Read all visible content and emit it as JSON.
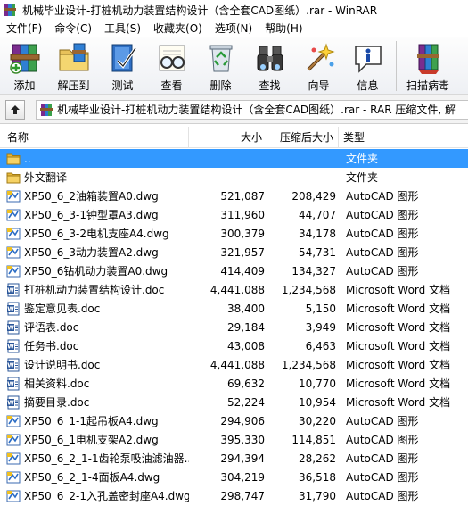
{
  "window": {
    "title": "机械毕业设计-打桩机动力装置结构设计（含全套CAD图纸）.rar - WinRAR"
  },
  "menu": [
    "文件(F)",
    "命令(C)",
    "工具(S)",
    "收藏夹(O)",
    "选项(N)",
    "帮助(H)"
  ],
  "toolbar": [
    {
      "label": "添加",
      "icon": "add-books-icon"
    },
    {
      "label": "解压到",
      "icon": "extract-folder-icon"
    },
    {
      "label": "测试",
      "icon": "test-check-icon"
    },
    {
      "label": "查看",
      "icon": "view-glasses-icon"
    },
    {
      "label": "删除",
      "icon": "delete-recycle-icon"
    },
    {
      "label": "查找",
      "icon": "find-binoculars-icon"
    },
    {
      "label": "向导",
      "icon": "wizard-wand-icon"
    },
    {
      "label": "信息",
      "icon": "info-icon"
    },
    {
      "label": "扫描病毒",
      "icon": "virus-scan-icon"
    }
  ],
  "address": {
    "text": "机械毕业设计-打桩机动力装置结构设计（含全套CAD图纸）.rar - RAR 压缩文件, 解"
  },
  "columns": {
    "name": "名称",
    "size": "大小",
    "packed": "压缩后大小",
    "type": "类型"
  },
  "colors": {
    "selection": "#3399ff",
    "folder": "#f0c24a",
    "dwg": "#2b6cc4",
    "doc": "#2b579a"
  },
  "files": [
    {
      "name": "..",
      "size": "",
      "packed": "",
      "type": "文件夹",
      "kind": "folder",
      "selected": true
    },
    {
      "name": "外文翻译",
      "size": "",
      "packed": "",
      "type": "文件夹",
      "kind": "folder"
    },
    {
      "name": "XP50_6_2油箱装置A0.dwg",
      "size": "521,087",
      "packed": "208,429",
      "type": "AutoCAD 图形",
      "kind": "dwg"
    },
    {
      "name": "XP50_6_3-1钟型罩A3.dwg",
      "size": "311,960",
      "packed": "44,707",
      "type": "AutoCAD 图形",
      "kind": "dwg"
    },
    {
      "name": "XP50_6_3-2电机支座A4.dwg",
      "size": "300,379",
      "packed": "34,178",
      "type": "AutoCAD 图形",
      "kind": "dwg"
    },
    {
      "name": "XP50_6_3动力装置A2.dwg",
      "size": "321,957",
      "packed": "54,731",
      "type": "AutoCAD 图形",
      "kind": "dwg"
    },
    {
      "name": "XP50_6钻机动力装置A0.dwg",
      "size": "414,409",
      "packed": "134,327",
      "type": "AutoCAD 图形",
      "kind": "dwg"
    },
    {
      "name": "打桩机动力装置结构设计.doc",
      "size": "4,441,088",
      "packed": "1,234,568",
      "type": "Microsoft Word 文档",
      "kind": "doc"
    },
    {
      "name": "鉴定意见表.doc",
      "size": "38,400",
      "packed": "5,150",
      "type": "Microsoft Word 文档",
      "kind": "doc"
    },
    {
      "name": "评语表.doc",
      "size": "29,184",
      "packed": "3,949",
      "type": "Microsoft Word 文档",
      "kind": "doc"
    },
    {
      "name": "任务书.doc",
      "size": "43,008",
      "packed": "6,463",
      "type": "Microsoft Word 文档",
      "kind": "doc"
    },
    {
      "name": "设计说明书.doc",
      "size": "4,441,088",
      "packed": "1,234,568",
      "type": "Microsoft Word 文档",
      "kind": "doc"
    },
    {
      "name": "相关资料.doc",
      "size": "69,632",
      "packed": "10,770",
      "type": "Microsoft Word 文档",
      "kind": "doc"
    },
    {
      "name": "摘要目录.doc",
      "size": "52,224",
      "packed": "10,954",
      "type": "Microsoft Word 文档",
      "kind": "doc"
    },
    {
      "name": "XP50_6_1-1起吊板A4.dwg",
      "size": "294,906",
      "packed": "30,220",
      "type": "AutoCAD 图形",
      "kind": "dwg"
    },
    {
      "name": "XP50_6_1电机支架A2.dwg",
      "size": "395,330",
      "packed": "114,851",
      "type": "AutoCAD 图形",
      "kind": "dwg"
    },
    {
      "name": "XP50_6_2_1-1齿轮泵吸油滤油器...",
      "size": "294,394",
      "packed": "28,262",
      "type": "AutoCAD 图形",
      "kind": "dwg"
    },
    {
      "name": "XP50_6_2_1-4面板A4.dwg",
      "size": "304,219",
      "packed": "36,518",
      "type": "AutoCAD 图形",
      "kind": "dwg"
    },
    {
      "name": "XP50_6_2-1入孔盖密封座A4.dwg",
      "size": "298,747",
      "packed": "31,790",
      "type": "AutoCAD 图形",
      "kind": "dwg"
    }
  ]
}
